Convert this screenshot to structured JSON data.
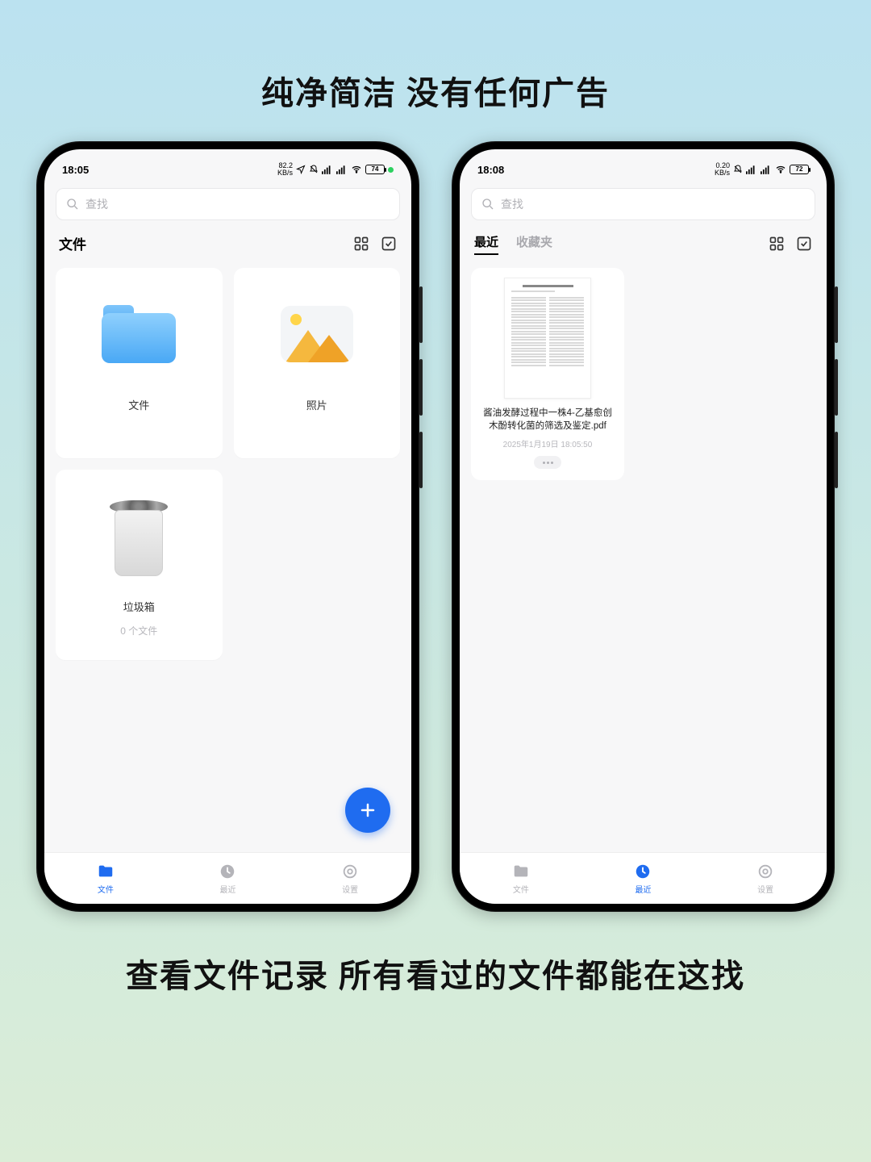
{
  "headline_top": "纯净简洁 没有任何广告",
  "headline_bottom": "查看文件记录 所有看过的文件都能在这找",
  "phone_left": {
    "status": {
      "time": "18:05",
      "net_speed": "82.2",
      "net_unit": "KB/s",
      "battery": "74"
    },
    "search_placeholder": "查找",
    "header_title": "文件",
    "cards": {
      "files": {
        "label": "文件"
      },
      "photos": {
        "label": "照片"
      },
      "trash": {
        "label": "垃圾箱",
        "sublabel": "0 个文件"
      }
    },
    "nav": {
      "files": "文件",
      "recent": "最近",
      "settings": "设置"
    }
  },
  "phone_right": {
    "status": {
      "time": "18:08",
      "net_speed": "0.20",
      "net_unit": "KB/s",
      "battery": "72"
    },
    "search_placeholder": "查找",
    "tabs": {
      "recent": "最近",
      "favorites": "收藏夹"
    },
    "recent_item": {
      "name": "酱油发酵过程中一株4-乙基愈创木酚转化菌的筛选及鉴定.pdf",
      "time": "2025年1月19日 18:05:50"
    },
    "nav": {
      "files": "文件",
      "recent": "最近",
      "settings": "设置"
    }
  }
}
